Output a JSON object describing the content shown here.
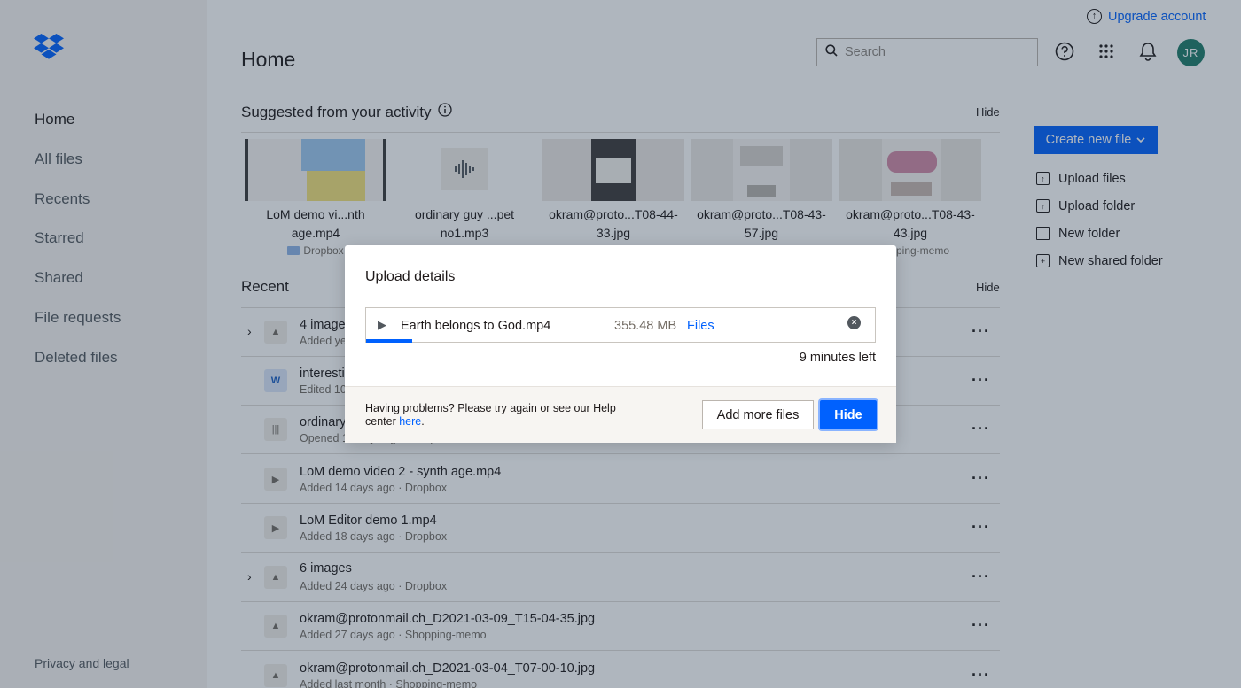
{
  "app": {
    "brand_color": "#0061fe",
    "avatar_color": "#1f7c69"
  },
  "sidebar": {
    "items": [
      {
        "label": "Home",
        "active": true
      },
      {
        "label": "All files"
      },
      {
        "label": "Recents"
      },
      {
        "label": "Starred"
      },
      {
        "label": "Shared"
      },
      {
        "label": "File requests"
      },
      {
        "label": "Deleted files"
      }
    ],
    "footer": "Privacy and legal"
  },
  "header": {
    "title": "Home",
    "upgrade_label": "Upgrade account",
    "search_placeholder": "Search",
    "avatar_initials": "JR"
  },
  "suggested": {
    "heading": "Suggested from your activity",
    "hide_label": "Hide",
    "cards": [
      {
        "name": "LoM demo vi...nth age.mp4",
        "location": "Dropbox"
      },
      {
        "name": "ordinary guy ...pet no1.mp3",
        "location": ""
      },
      {
        "name": "okram@proto...T08-44-33.jpg",
        "location": ""
      },
      {
        "name": "okram@proto...T08-43-57.jpg",
        "location": ""
      },
      {
        "name": "okram@proto...T08-43-43.jpg",
        "location": "Shopping-memo"
      }
    ]
  },
  "recent": {
    "heading": "Recent",
    "hide_label": "Hide",
    "rows": [
      {
        "title": "4 images",
        "meta": "Added yesterday · Dropbox",
        "expandable": true
      },
      {
        "title": "interesting document.docx",
        "meta": "Edited 10 days ago · Dropbox"
      },
      {
        "title": "ordinary guy - trumpet no1.mp3",
        "meta": "Opened 12 days ago · Dropbox"
      },
      {
        "title": "LoM demo video 2 - synth age.mp4",
        "meta": "Added 14 days ago · Dropbox"
      },
      {
        "title": "LoM Editor demo 1.mp4",
        "meta": "Added 18 days ago · Dropbox"
      },
      {
        "title": "6 images",
        "meta": "Added 24 days ago · Dropbox",
        "expandable": true
      },
      {
        "title": "okram@protonmail.ch_D2021-03-09_T15-04-35.jpg",
        "meta": "Added 27 days ago · Shopping-memo"
      },
      {
        "title": "okram@protonmail.ch_D2021-03-04_T07-00-10.jpg",
        "meta": "Added last month · Shopping-memo"
      }
    ]
  },
  "right_panel": {
    "create_label": "Create new file",
    "actions": [
      "Upload files",
      "Upload folder",
      "New folder",
      "New shared folder"
    ]
  },
  "upload_modal": {
    "title": "Upload details",
    "file_name": "Earth belongs to God.mp4",
    "file_size": "355.48 MB",
    "destination": "Files",
    "progress": 0.09,
    "time_left": "9 minutes left",
    "help_text": "Having problems? Please try again or see our Help center ",
    "help_link": "here",
    "add_more_label": "Add more files",
    "hide_label": "Hide"
  }
}
